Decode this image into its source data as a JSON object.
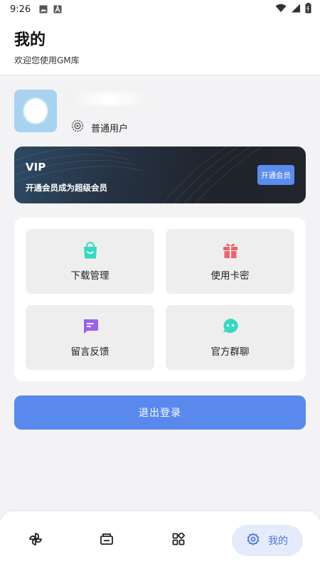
{
  "status_bar": {
    "time": "9:26",
    "icons": [
      "image-icon",
      "a-letter-icon",
      "wifi-icon",
      "signal-icon",
      "battery-icon"
    ]
  },
  "header": {
    "title": "我的",
    "subtitle": "欢迎您使用GM库"
  },
  "profile": {
    "level": "普通用户",
    "icons": [
      "avatar-image",
      "level-badge-icon"
    ]
  },
  "vip": {
    "title": "VIP",
    "description": "开通会员成为超级会员",
    "button_label": "开通会员"
  },
  "features": [
    {
      "label": "下载管理",
      "icon": "shopping-bag-icon",
      "color": "#34d9c3"
    },
    {
      "label": "使用卡密",
      "icon": "gift-icon",
      "color": "#f2616b"
    },
    {
      "label": "留言反馈",
      "icon": "message-icon",
      "color": "#9a61ee"
    },
    {
      "label": "官方群聊",
      "icon": "chat-face-icon",
      "color": "#34d9c3"
    }
  ],
  "logout_label": "退出登录",
  "bottom_nav": {
    "items": [
      {
        "icon": "pinwheel-icon"
      },
      {
        "icon": "ticket-icon"
      },
      {
        "icon": "apps-grid-icon"
      },
      {
        "icon": "gear-icon",
        "label": "我的",
        "active": true
      }
    ]
  },
  "colors": {
    "accent": "#5a89ee",
    "active_nav_bg": "#e4ecfb",
    "active_nav_text": "#4c78dc",
    "avatar_bg": "#a7d3ef",
    "vip_card": "#23262c"
  }
}
